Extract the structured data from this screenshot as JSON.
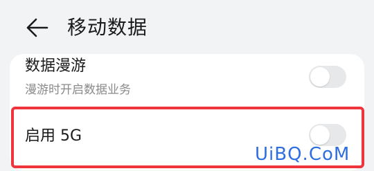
{
  "header": {
    "back_icon": "arrow-left-icon",
    "title": "移动数据"
  },
  "settings": [
    {
      "label": "数据漫游",
      "description": "漫游时开启数据业务",
      "enabled": false
    },
    {
      "label": "启用 5G",
      "enabled": false
    }
  ],
  "watermark": "UiBQ.CoM",
  "colors": {
    "background": "#f1f3f5",
    "card": "#ffffff",
    "highlight": "#f0343c",
    "toggle_off": "#e7e8ea",
    "watermark": "#2f6ee0"
  }
}
